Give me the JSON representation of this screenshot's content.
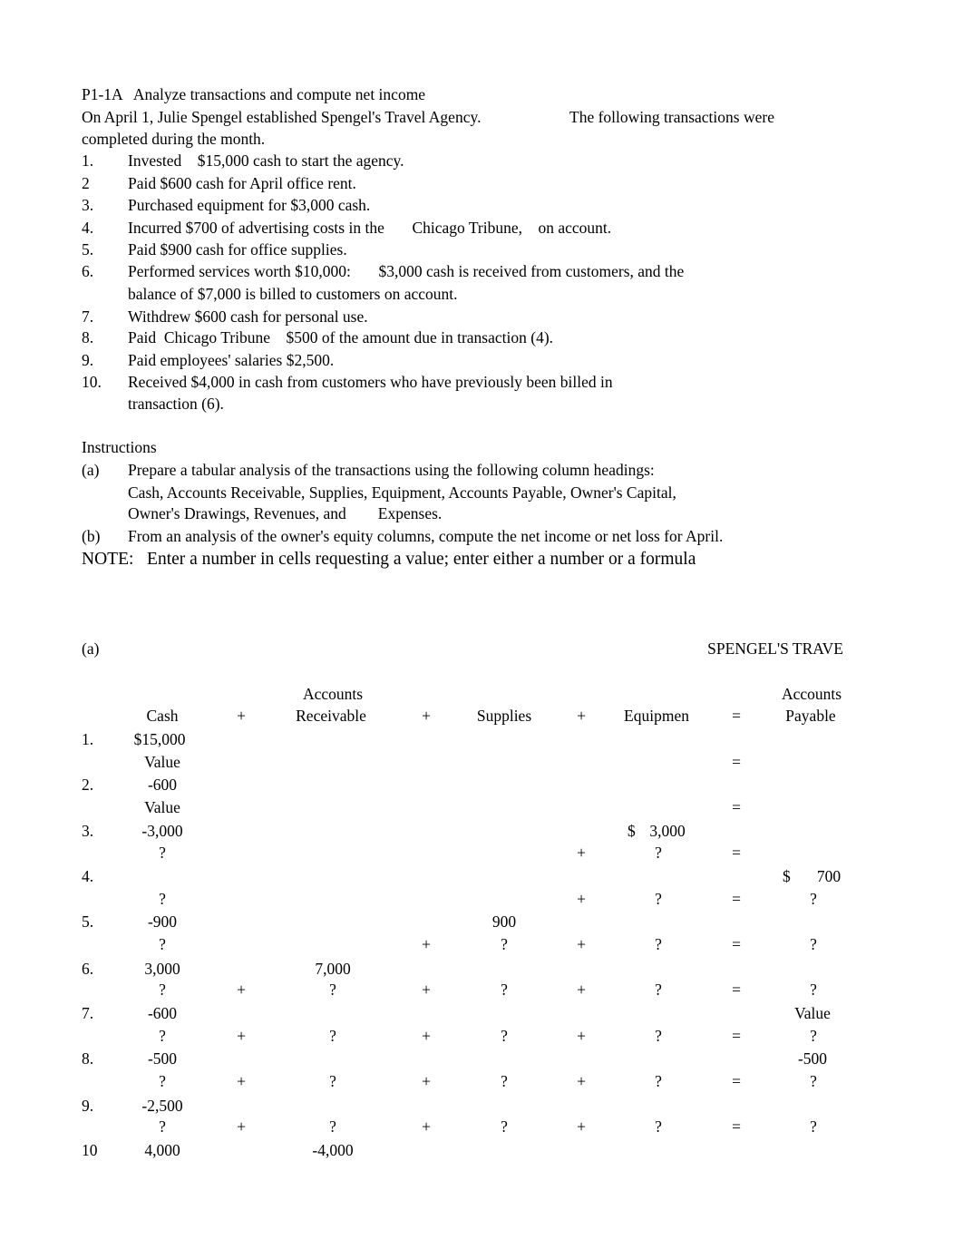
{
  "header": {
    "title": "P1-1A   Analyze transactions and compute net income",
    "intro_line1": "On April 1, Julie Spengel established Spengel's Travel Agency.",
    "intro_line1b": "The following transactions were",
    "intro_line2": "completed during the month."
  },
  "transactions": [
    {
      "num": "1.",
      "lines": [
        "Invested    $15,000 cash to start the agency."
      ]
    },
    {
      "num": "2",
      "lines": [
        "Paid $600 cash for April office rent."
      ]
    },
    {
      "num": "3.",
      "lines": [
        "Purchased equipment for $3,000 cash."
      ]
    },
    {
      "num": "4.",
      "lines": [
        "Incurred $700 of advertising costs in the       Chicago Tribune,    on account."
      ]
    },
    {
      "num": "5.",
      "lines": [
        "Paid $900 cash for office supplies."
      ]
    },
    {
      "num": "6.",
      "lines": [
        "Performed services worth $10,000:       $3,000 cash is received from customers, and the",
        "balance of $7,000 is billed to customers on account."
      ]
    },
    {
      "num": "7.",
      "lines": [
        "Withdrew $600 cash for personal use."
      ]
    },
    {
      "num": "8.",
      "lines": [
        "Paid  Chicago Tribune    $500 of the amount due in transaction (4)."
      ]
    },
    {
      "num": "9.",
      "lines": [
        "Paid employees' salaries $2,500."
      ]
    },
    {
      "num": "10.",
      "lines": [
        "Received $4,000 in cash from customers who have previously been billed in",
        "transaction (6)."
      ]
    }
  ],
  "instructions": {
    "heading": "Instructions",
    "a_label": "(a)",
    "a_lines": [
      "Prepare a tabular analysis of the transactions using the following column headings:",
      "Cash, Accounts Receivable, Supplies, Equipment, Accounts Payable, Owner's Capital,",
      "Owner's Drawings, Revenues, and        Expenses."
    ],
    "b_label": "(b)",
    "b_text": "From an analysis of the owner's equity columns, compute the net income or net loss for April.",
    "note": "NOTE:   Enter a number in cells requesting a value; enter either a number or a formula"
  },
  "worksheet": {
    "part_label": "(a)",
    "company_title": "SPENGEL'S TRAVE",
    "headers": {
      "cash": "Cash",
      "plus1": "+",
      "ar_top": "Accounts",
      "ar_bottom": "Receivable",
      "plus2": "+",
      "supplies": "Supplies",
      "plus3": "+",
      "equipment": "Equipmen",
      "equals": "=",
      "ap_top": "Accounts",
      "ap_bottom": "Payable"
    },
    "rows": [
      {
        "num": "1.",
        "cash": "$15,000",
        "ar": "",
        "sup": "",
        "eq_dollar": "",
        "eq": "",
        "ap_dollar": "",
        "ap": ""
      },
      {
        "num": "",
        "cash": "Value",
        "p1": "",
        "ar": "",
        "p2": "",
        "sup": "",
        "p3": "",
        "eq": "",
        "eqs": "=",
        "ap": ""
      },
      {
        "num": "2.",
        "cash": "-600"
      },
      {
        "num": "",
        "cash": "Value",
        "eqs": "="
      },
      {
        "num": "3.",
        "cash": "-3,000",
        "eq_dollar": "$",
        "eq": "3,000"
      },
      {
        "num": "",
        "cash": "?",
        "p3": "+",
        "eq": "?",
        "eqs": "="
      },
      {
        "num": "4.",
        "ap_dollar": "$",
        "ap": "700"
      },
      {
        "num": "",
        "cash": "?",
        "p3": "+",
        "eq": "?",
        "eqs": "=",
        "ap": "?"
      },
      {
        "num": "5.",
        "cash": "-900",
        "sup": "900"
      },
      {
        "num": "",
        "cash": "?",
        "p2": "+",
        "sup": "?",
        "p3": "+",
        "eq": "?",
        "eqs": "=",
        "ap": "?"
      },
      {
        "num": "6.",
        "cash": "3,000",
        "ar": "7,000"
      },
      {
        "num": "",
        "cash": "?",
        "p1": "+",
        "ar": "?",
        "p2": "+",
        "sup": "?",
        "p3": "+",
        "eq": "?",
        "eqs": "=",
        "ap": "?"
      },
      {
        "num": "7.",
        "cash": "-600",
        "ap": "Value"
      },
      {
        "num": "",
        "cash": "?",
        "p1": "+",
        "ar": "?",
        "p2": "+",
        "sup": "?",
        "p3": "+",
        "eq": "?",
        "eqs": "=",
        "ap": "?"
      },
      {
        "num": "8.",
        "cash": "-500",
        "ap": "-500"
      },
      {
        "num": "",
        "cash": "?",
        "p1": "+",
        "ar": "?",
        "p2": "+",
        "sup": "?",
        "p3": "+",
        "eq": "?",
        "eqs": "=",
        "ap": "?"
      },
      {
        "num": "9.",
        "cash": "-2,500"
      },
      {
        "num": "",
        "cash": "?",
        "p1": "+",
        "ar": "?",
        "p2": "+",
        "sup": "?",
        "p3": "+",
        "eq": "?",
        "eqs": "=",
        "ap": "?"
      },
      {
        "num": "10",
        "cash": "4,000",
        "ar": "-4,000"
      }
    ]
  }
}
